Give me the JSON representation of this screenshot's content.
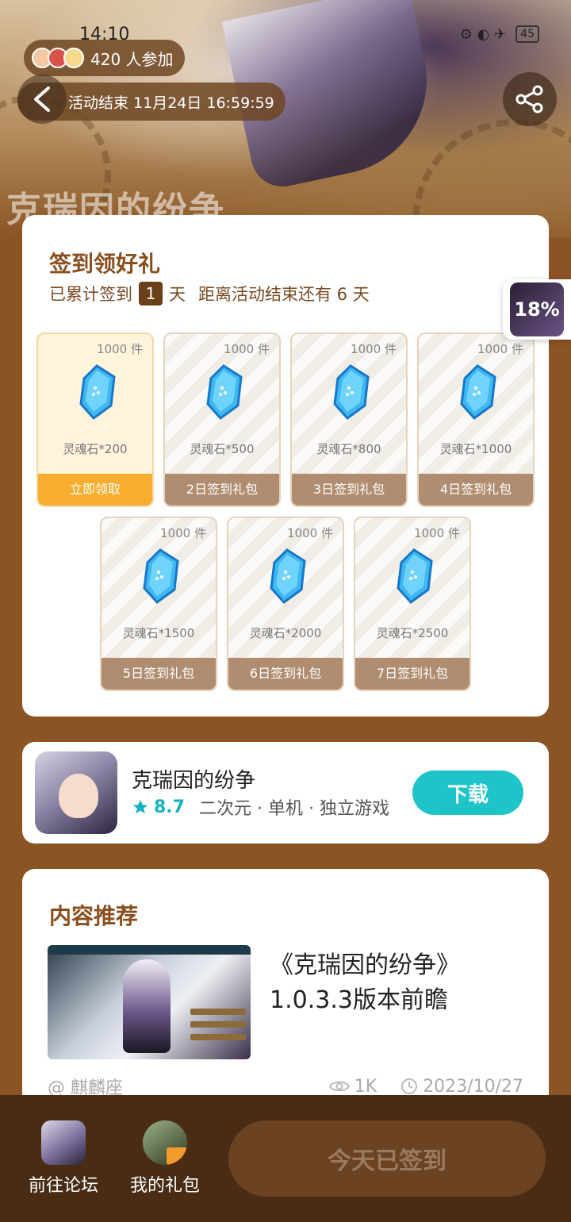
{
  "status_bar": {
    "time": "14:10",
    "battery": "45"
  },
  "hero": {
    "participants_text": "420 人参加",
    "deadline_text": "活动结束 11月24日 16:59:59",
    "logo_text": "克瑞因的纷争"
  },
  "signin": {
    "title": "签到领好礼",
    "cumulative_prefix": "已累计签到",
    "cumulative_days": "1",
    "day_unit": "天",
    "remaining_text": "距离活动结束还有 6 天",
    "gifts": [
      {
        "qty": "1000 件",
        "name": "灵魂石*200",
        "label": "立即领取"
      },
      {
        "qty": "1000 件",
        "name": "灵魂石*500",
        "label": "2日签到礼包"
      },
      {
        "qty": "1000 件",
        "name": "灵魂石*800",
        "label": "3日签到礼包"
      },
      {
        "qty": "1000 件",
        "name": "灵魂石*1000",
        "label": "4日签到礼包"
      },
      {
        "qty": "1000 件",
        "name": "灵魂石*1500",
        "label": "5日签到礼包"
      },
      {
        "qty": "1000 件",
        "name": "灵魂石*2000",
        "label": "6日签到礼包"
      },
      {
        "qty": "1000 件",
        "name": "灵魂石*2500",
        "label": "7日签到礼包"
      }
    ]
  },
  "side_progress": {
    "percent": "18%"
  },
  "game": {
    "name": "克瑞因的纷争",
    "rating": "8.7",
    "tags": "二次元 · 单机 · 独立游戏",
    "download_label": "下载"
  },
  "content": {
    "title": "内容推荐",
    "article_title_line1": "《克瑞因的纷争》",
    "article_title_line2": "1.0.3.3版本前瞻",
    "author": "@ 麒麟座",
    "views": "1K",
    "date": "2023/10/27"
  },
  "bottom": {
    "forum_label": "前往论坛",
    "gifts_label": "我的礼包",
    "checked_label": "今天已签到"
  },
  "colors": {
    "accent": "#f7ad2e",
    "download": "#1ec4c8",
    "brown": "#8a5424"
  }
}
